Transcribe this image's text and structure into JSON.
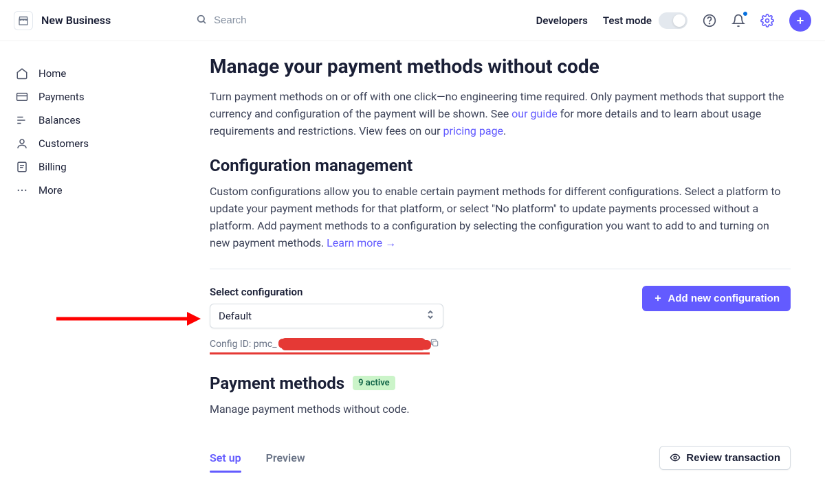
{
  "brand": "New Business",
  "search": {
    "placeholder": "Search"
  },
  "topbar": {
    "developers": "Developers",
    "testmode": "Test mode"
  },
  "sidebar": {
    "items": [
      {
        "label": "Home"
      },
      {
        "label": "Payments"
      },
      {
        "label": "Balances"
      },
      {
        "label": "Customers"
      },
      {
        "label": "Billing"
      },
      {
        "label": "More"
      }
    ]
  },
  "section1": {
    "title": "Manage your payment methods without code",
    "desc_pre": "Turn payment methods on or off with one click—no engineering time required. Only payment methods that support the currency and configuration of the payment will be shown. See ",
    "link_guide": "our guide",
    "desc_mid": " for more details and to learn about usage requirements and restrictions. View fees on our ",
    "link_pricing": "pricing page",
    "desc_end": "."
  },
  "section2": {
    "title": "Configuration management",
    "desc": "Custom configurations allow you to enable certain payment methods for different configurations. Select a platform to update your payment methods for that platform, or select \"No platform\" to update payments processed without a platform. Add payment methods to a configuration by selecting the configuration you want to add to and turning on new payment methods. ",
    "learn_more": "Learn more →"
  },
  "config": {
    "select_label": "Select configuration",
    "selected": "Default",
    "id_label": "Config ID: pmc_",
    "add_button": "Add new configuration"
  },
  "methods": {
    "title": "Payment methods",
    "badge": "9 active",
    "desc": "Manage payment methods without code."
  },
  "tabs": {
    "setup": "Set up",
    "preview": "Preview"
  },
  "review_btn": "Review transaction"
}
